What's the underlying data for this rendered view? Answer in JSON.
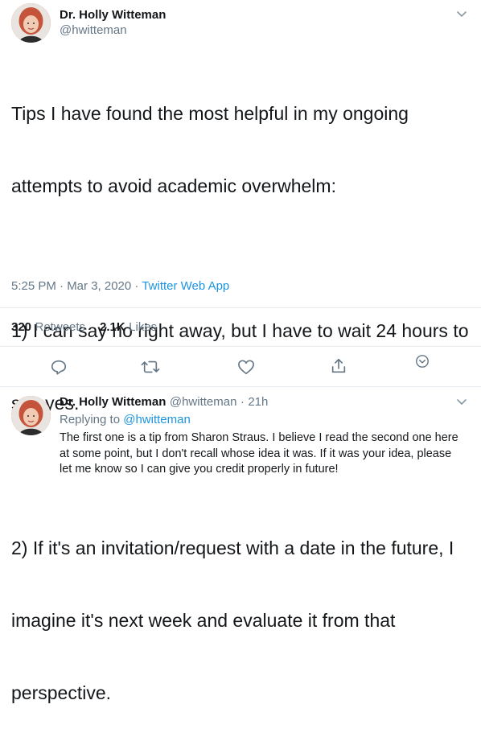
{
  "tweet": {
    "author_name": "Dr. Holly Witteman",
    "author_handle": "@hwitteman",
    "text_lines": [
      "Tips I have found the most helpful in my ongoing",
      "attempts to avoid academic overwhelm:",
      "",
      "1) I can say no right away, but I have to wait 24 hours to",
      "say yes.",
      "",
      "2) If it's an invitation/request with a date in the future, I",
      "imagine it's next week and evaluate it from that",
      "perspective."
    ],
    "timestamp": "5:25 PM · Mar 3, 2020 · ",
    "source": "Twitter Web App",
    "retweets_count": "320",
    "retweets_label": "Retweets",
    "likes_count": "2.1K",
    "likes_label": "Likes"
  },
  "actions": {
    "icons": [
      "reply-icon",
      "retweet-icon",
      "like-icon",
      "share-icon",
      "chevron-circle-icon"
    ]
  },
  "reply": {
    "author_name": "Dr. Holly Witteman",
    "author_handle": "@hwitteman",
    "separator": "·",
    "time": "21h",
    "replying_to_label": "Replying to ",
    "replying_to_handle": "@hwitteman",
    "text_lines": [
      "The first one is a tip from Sharon Straus. I believe I read the second one here",
      "at some point, but I don't recall whose idea it was. If it was your idea, please",
      "let me know so I can give you credit properly in future!"
    ]
  },
  "colors": {
    "link": "#1b95e0",
    "secondary_text": "#657786",
    "divider": "#e6ecf0",
    "primary_text": "#14171a"
  }
}
